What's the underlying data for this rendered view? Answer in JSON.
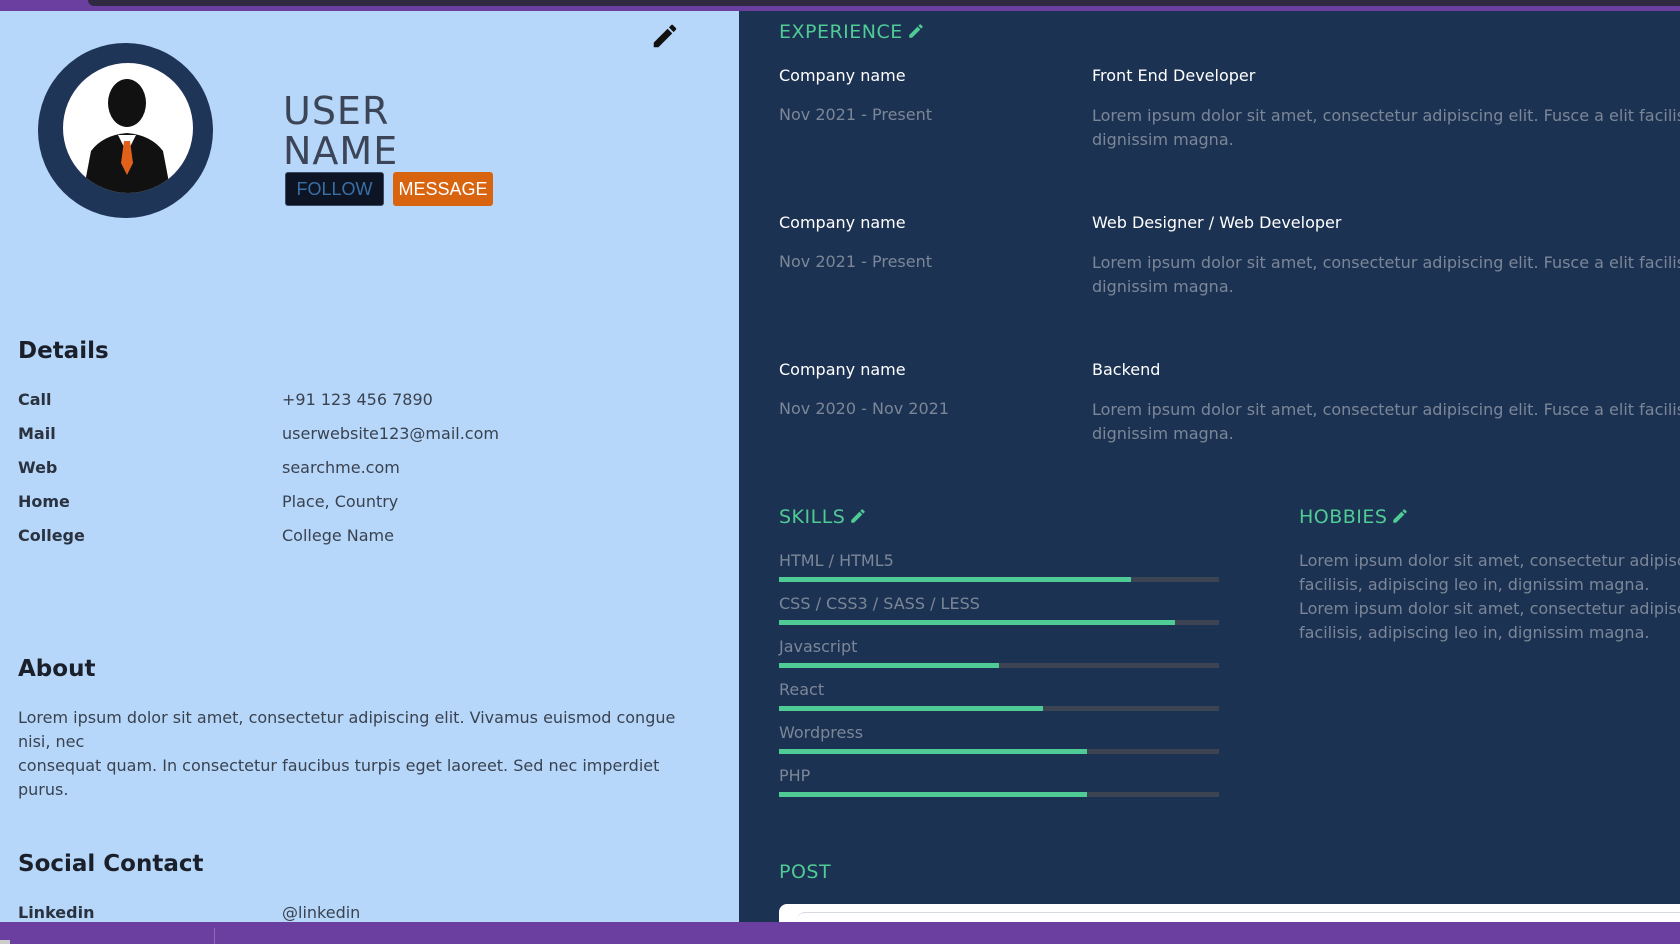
{
  "profile": {
    "name_line1": "USER",
    "name_line2": "NAME",
    "follow_label": "FOLLOW",
    "message_label": "MESSAGE"
  },
  "details": {
    "title": "Details",
    "rows": [
      {
        "label": "Call",
        "value": "+91 123 456 7890"
      },
      {
        "label": "Mail",
        "value": "userwebsite123@mail.com"
      },
      {
        "label": "Web",
        "value": "searchme.com"
      },
      {
        "label": "Home",
        "value": "Place, Country"
      },
      {
        "label": "College",
        "value": "College Name"
      }
    ]
  },
  "about": {
    "title": "About",
    "text_line1": "Lorem ipsum dolor sit amet, consectetur adipiscing elit. Vivamus euismod congue nisi, nec",
    "text_line2": "consequat quam. In consectetur faucibus turpis eget laoreet. Sed nec imperdiet purus."
  },
  "social": {
    "title": "Social Contact",
    "rows": [
      {
        "label": "Linkedin",
        "value": "@linkedin"
      }
    ]
  },
  "experience": {
    "title": "EXPERIENCE",
    "items": [
      {
        "company": "Company name",
        "date": "Nov 2021 - Present",
        "role": "Front End Developer",
        "desc_line1": "Lorem ipsum dolor sit amet, consectetur adipiscing elit. Fusce a elit facilisis, adipiscing",
        "desc_line2": "dignissim magna."
      },
      {
        "company": "Company name",
        "date": "Nov 2021 - Present",
        "role": "Web Designer / Web Developer",
        "desc_line1": "Lorem ipsum dolor sit amet, consectetur adipiscing elit. Fusce a elit facilisis, adipiscing",
        "desc_line2": "dignissim magna."
      },
      {
        "company": "Company name",
        "date": "Nov 2020 - Nov 2021",
        "role": "Backend",
        "desc_line1": "Lorem ipsum dolor sit amet, consectetur adipiscing elit. Fusce a elit facilisis, adipiscing",
        "desc_line2": "dignissim magna."
      }
    ]
  },
  "skills": {
    "title": "SKILLS",
    "items": [
      {
        "name": "HTML / HTML5",
        "level": 0.8
      },
      {
        "name": "CSS / CSS3 / SASS / LESS",
        "level": 0.9
      },
      {
        "name": "Javascript",
        "level": 0.5
      },
      {
        "name": "React",
        "level": 0.6
      },
      {
        "name": "Wordpress",
        "level": 0.7
      },
      {
        "name": "PHP",
        "level": 0.7
      }
    ]
  },
  "hobbies": {
    "title": "HOBBIES",
    "line1": "Lorem ipsum dolor sit amet, consectetur adipiscing elit.",
    "line2": "facilisis, adipiscing leo in, dignissim magna.",
    "line3": "Lorem ipsum dolor sit amet, consectetur adipiscing elit.",
    "line4": "facilisis, adipiscing leo in, dignissim magna."
  },
  "post": {
    "title": "POST"
  },
  "colors": {
    "accent": "#4fcb95",
    "left_panel": "#b6d7f9",
    "right_panel": "#1c3252",
    "message_button": "#d86410",
    "frame": "#6b3fa0"
  },
  "icons": {
    "edit": "pencil-icon",
    "avatar": "user-silhouette-icon"
  }
}
